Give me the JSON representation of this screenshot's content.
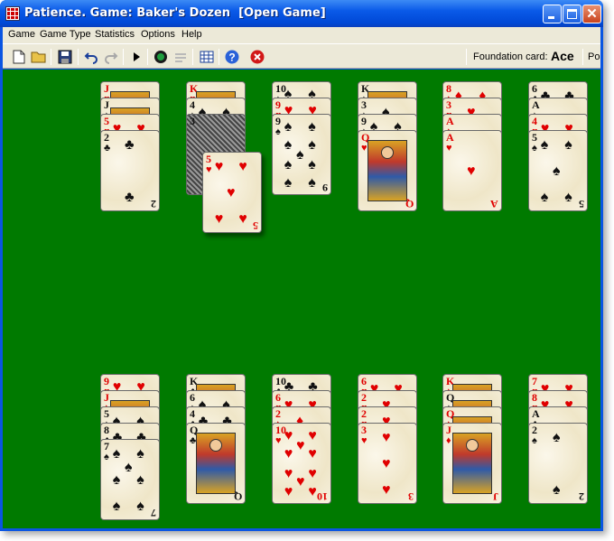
{
  "window": {
    "title": "Patience. Game: Baker's Dozen  [Open Game]"
  },
  "menu": [
    "Game",
    "Game Type",
    "Statistics",
    "Options",
    "Help"
  ],
  "toolbar": {
    "buttons": [
      "new-icon",
      "open-icon",
      "save-icon",
      "undo-icon",
      "redo-icon",
      "play-icon",
      "autoplay-icon",
      "hint-icon",
      "calculator-icon",
      "help-icon",
      "stop-icon"
    ],
    "foundation_label": "Foundation card:",
    "foundation_value": "Ace",
    "extra_label": "Po"
  },
  "colors": {
    "felt": "#007a00",
    "red_suit": "#e00000",
    "black_suit": "#111111",
    "title_bar": "#0a5ae8"
  },
  "tableau": {
    "top_row": [
      {
        "cards": [
          {
            "rank": "J",
            "suit": "♥"
          },
          {
            "rank": "J",
            "suit": "♠"
          },
          {
            "rank": "5",
            "suit": "♥"
          },
          {
            "rank": "2",
            "suit": "♣"
          }
        ]
      },
      {
        "cards": [
          {
            "rank": "K",
            "suit": "♥"
          },
          {
            "rank": "4",
            "suit": "♠"
          },
          {
            "rank": "3",
            "suit": "♣"
          }
        ],
        "dragging": {
          "rank": "5",
          "suit": "♥"
        }
      },
      {
        "cards": [
          {
            "rank": "10",
            "suit": "♠"
          },
          {
            "rank": "9",
            "suit": "♥"
          },
          {
            "rank": "9",
            "suit": "♠"
          }
        ]
      },
      {
        "cards": [
          {
            "rank": "K",
            "suit": "♠"
          },
          {
            "rank": "3",
            "suit": "♠"
          },
          {
            "rank": "9",
            "suit": "♠"
          },
          {
            "rank": "Q",
            "suit": "♥"
          }
        ]
      },
      {
        "cards": [
          {
            "rank": "8",
            "suit": "♦"
          },
          {
            "rank": "3",
            "suit": "♥"
          },
          {
            "rank": "A",
            "suit": "♦"
          },
          {
            "rank": "A",
            "suit": "♥"
          }
        ]
      },
      {
        "cards": [
          {
            "rank": "6",
            "suit": "♣"
          },
          {
            "rank": "A",
            "suit": "♠"
          },
          {
            "rank": "4",
            "suit": "♥"
          },
          {
            "rank": "5",
            "suit": "♠"
          }
        ]
      }
    ],
    "bottom_row": [
      {
        "cards": [
          {
            "rank": "9",
            "suit": "♥"
          },
          {
            "rank": "J",
            "suit": "♦"
          },
          {
            "rank": "5",
            "suit": "♠"
          },
          {
            "rank": "8",
            "suit": "♣"
          },
          {
            "rank": "7",
            "suit": "♠"
          }
        ]
      },
      {
        "cards": [
          {
            "rank": "K",
            "suit": "♣"
          },
          {
            "rank": "6",
            "suit": "♠"
          },
          {
            "rank": "4",
            "suit": "♣"
          },
          {
            "rank": "Q",
            "suit": "♣"
          }
        ]
      },
      {
        "cards": [
          {
            "rank": "10",
            "suit": "♣"
          },
          {
            "rank": "6",
            "suit": "♥"
          },
          {
            "rank": "2",
            "suit": "♦"
          },
          {
            "rank": "10",
            "suit": "♥"
          }
        ]
      },
      {
        "cards": [
          {
            "rank": "6",
            "suit": "♥"
          },
          {
            "rank": "2",
            "suit": "♥"
          },
          {
            "rank": "2",
            "suit": "♥"
          },
          {
            "rank": "3",
            "suit": "♥"
          }
        ]
      },
      {
        "cards": [
          {
            "rank": "K",
            "suit": "♦"
          },
          {
            "rank": "Q",
            "suit": "♠"
          },
          {
            "rank": "Q",
            "suit": "♦"
          },
          {
            "rank": "J",
            "suit": "♦"
          }
        ]
      },
      {
        "cards": [
          {
            "rank": "7",
            "suit": "♥"
          },
          {
            "rank": "8",
            "suit": "♥"
          },
          {
            "rank": "A",
            "suit": "♣"
          },
          {
            "rank": "2",
            "suit": "♠"
          }
        ]
      }
    ]
  }
}
